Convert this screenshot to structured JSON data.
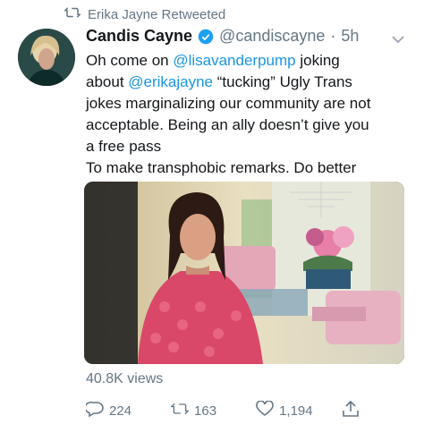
{
  "retweet": {
    "text": "Erika Jayne Retweeted",
    "icon": "retweet-icon"
  },
  "tweet": {
    "author": {
      "name": "Candis Cayne",
      "handle": "@candiscayne",
      "time": "5h",
      "separator": "·"
    },
    "body": {
      "l1_pre": "Oh come on ",
      "mention1": "@lisavanderpump",
      "l1_post": " joking",
      "l2_pre": "about ",
      "mention2": "@erikajayne",
      "l2_post": " “tucking” Ugly Trans",
      "l3": "jokes marginalizing our community are not",
      "l4": "acceptable.  Being an ally doesn’t give you",
      "l5": "a free pass",
      "l6": "To make transphobic remarks. Do better"
    },
    "views": "40.8K views",
    "actions": {
      "replies": "224",
      "retweets": "163",
      "likes": "1,194"
    }
  },
  "colors": {
    "link": "#1b95e0",
    "muted": "#657786",
    "verified": "#1da1f2"
  }
}
